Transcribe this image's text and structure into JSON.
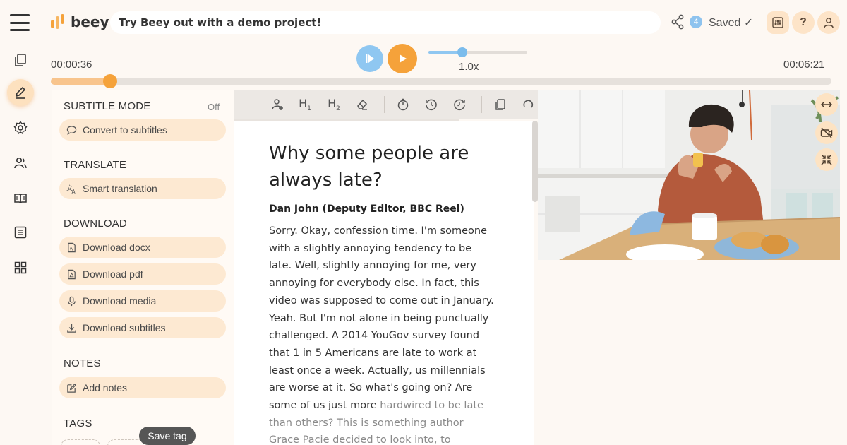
{
  "header": {
    "brand": "beey",
    "project_title": "Try Beey out with a demo project!",
    "collaborators_count": "4",
    "save_status": "Saved ✓"
  },
  "player": {
    "current_time": "00:00:36",
    "total_time": "00:06:21",
    "speed_label": "1.0x",
    "progress_fraction": 0.076,
    "speed_fraction": 0.34
  },
  "panel": {
    "subtitle_mode": {
      "title": "SUBTITLE MODE",
      "state": "Off",
      "convert": "Convert to subtitles"
    },
    "translate": {
      "title": "TRANSLATE",
      "smart": "Smart translation"
    },
    "download": {
      "title": "DOWNLOAD",
      "items": [
        "Download docx",
        "Download pdf",
        "Download media",
        "Download subtitles"
      ]
    },
    "notes": {
      "title": "NOTES",
      "add": "Add notes"
    },
    "tags": {
      "title": "TAGS",
      "tooltip": "Save tag"
    }
  },
  "editor": {
    "title": "Why some people are always late?",
    "speaker": "Dan John (Deputy Editor, BBC Reel)",
    "text_main": "Sorry. Okay, confession time. I'm someone with a slightly annoying tendency to be late. Well, slightly annoying for me, very annoying for everybody else. In fact, this video was supposed to come out in January. Yeah. But I'm not alone in being punctually challenged. A 2014 YouGov survey found that 1 in 5 Americans are late to work at least once a week. Actually, us millennials are worse at it. So what's going on? Are some of us just more ",
    "text_dim": "hardwired to be late than others? This is something author Grace Pacie decided to look into, to"
  },
  "colors": {
    "accent_orange": "#f5a23a",
    "accent_blue": "#8fc7f1",
    "soft_peach": "#fde9d2"
  },
  "icons": {
    "rail": [
      "copy-icon",
      "pen-icon",
      "settings-icon",
      "speakers-icon",
      "book-icon",
      "list-icon",
      "grid-icon"
    ]
  }
}
